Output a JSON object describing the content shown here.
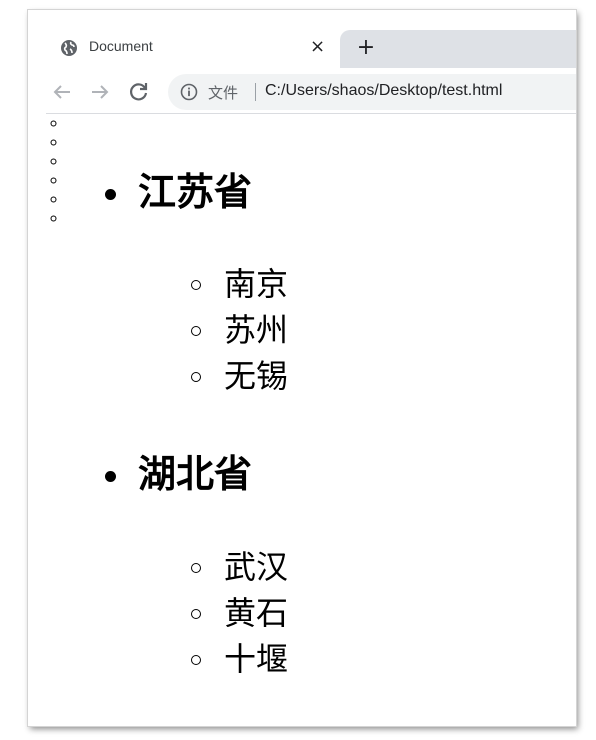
{
  "tab": {
    "title": "Document",
    "close_glyph": "×",
    "favicon": "globe-icon"
  },
  "newtab": {
    "glyph": "+"
  },
  "toolbar": {
    "back_icon": "arrow-left-icon",
    "forward_icon": "arrow-right-icon",
    "reload_icon": "reload-icon",
    "info_icon": "info-icon",
    "scheme_label": "文件",
    "url": "C:/Users/shaos/Desktop/test.html"
  },
  "content": {
    "provinces": [
      {
        "name": "江苏省",
        "cities": [
          "南京",
          "苏州",
          "无锡"
        ]
      },
      {
        "name": "湖北省",
        "cities": [
          "武汉",
          "黄石",
          "十堰"
        ]
      }
    ]
  }
}
